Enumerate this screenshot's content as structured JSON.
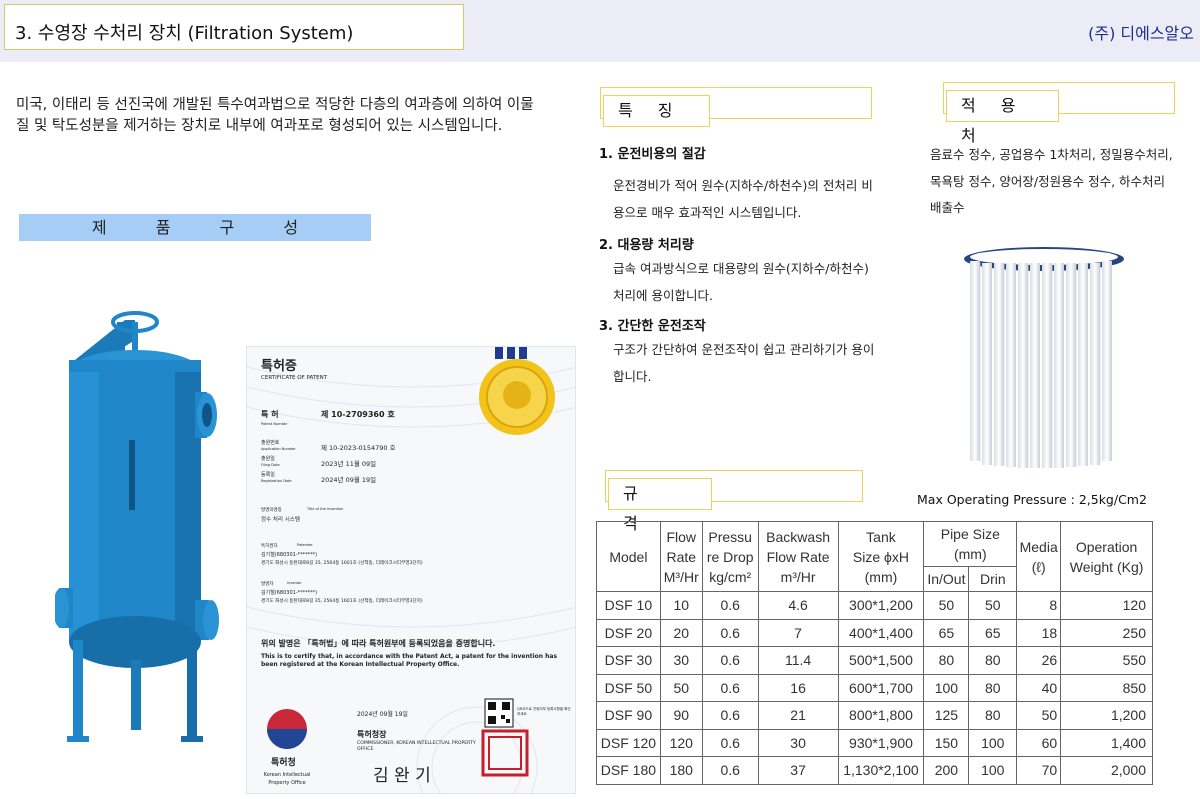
{
  "header": {
    "title": "3. 수영장 수처리 장치 (Filtration System)",
    "company": "(주) 디에스알오"
  },
  "intro": {
    "text": "미국, 이태리 등 선진국에 개발된 특수여과법으로 적당한 다층의 여과층에 의하여 이물질 및 탁도성분을 제거하는 장치로 내부에 여과포로 형성되어 있는 시스템입니다."
  },
  "composition": {
    "label": "제 품 구 성"
  },
  "features": {
    "heading": "특 징",
    "items": [
      {
        "title": "1. 운전비용의 절감",
        "desc": "운전경비가 적어 원수(지하수/하천수)의 전처리 비용으로 매우 효과적인 시스템입니다."
      },
      {
        "title": "2. 대용량 처리량",
        "desc": "급속 여과방식으로 대용량의 원수(지하수/하천수) 처리에 용이합니다."
      },
      {
        "title": "3. 간단한 운전조작",
        "desc": "구조가 간단하여 운전조작이 쉽고 관리하기가 용이합니다."
      }
    ]
  },
  "application": {
    "heading": "적 용 처",
    "text": "음료수 정수, 공업용수 1차처리, 정밀용수처리, 목욕탕 정수, 양어장/정원용수 정수, 하수처리 배출수"
  },
  "spec": {
    "heading": "규 격",
    "max_pressure": "Max Operating Pressure : 2,5kg/Cm2",
    "headers": {
      "model": "Model",
      "flow": [
        "Flow",
        "Rate",
        "M³/Hr"
      ],
      "pressure": [
        "Pressu",
        "re Drop",
        "kg/cm²"
      ],
      "backwash": [
        "Backwash",
        "Flow Rate",
        "m³/Hr"
      ],
      "tank": [
        "Tank",
        "Size ϕxH",
        "(mm)"
      ],
      "pipe": [
        "Pipe Size",
        "(mm)"
      ],
      "inout": "In/Out",
      "drin": "Drin",
      "media": [
        "Media",
        "(ℓ)"
      ],
      "weight": [
        "Operation",
        "Weight (Kg)"
      ]
    },
    "rows": [
      {
        "model": "DSF 10",
        "flow": "10",
        "pressure": "0.6",
        "backwash": "4.6",
        "tank": "300*1,200",
        "inout": "50",
        "drin": "50",
        "media": "8",
        "weight": "120"
      },
      {
        "model": "DSF 20",
        "flow": "20",
        "pressure": "0.6",
        "backwash": "7",
        "tank": "400*1,400",
        "inout": "65",
        "drin": "65",
        "media": "18",
        "weight": "250"
      },
      {
        "model": "DSF 30",
        "flow": "30",
        "pressure": "0.6",
        "backwash": "11.4",
        "tank": "500*1,500",
        "inout": "80",
        "drin": "80",
        "media": "26",
        "weight": "550"
      },
      {
        "model": "DSF 50",
        "flow": "50",
        "pressure": "0.6",
        "backwash": "16",
        "tank": "600*1,700",
        "inout": "100",
        "drin": "80",
        "media": "40",
        "weight": "850"
      },
      {
        "model": "DSF 90",
        "flow": "90",
        "pressure": "0.6",
        "backwash": "21",
        "tank": "800*1,800",
        "inout": "125",
        "drin": "80",
        "media": "50",
        "weight": "1,200"
      },
      {
        "model": "DSF 120",
        "flow": "120",
        "pressure": "0.6",
        "backwash": "30",
        "tank": "930*1,900",
        "inout": "150",
        "drin": "100",
        "media": "60",
        "weight": "1,400"
      },
      {
        "model": "DSF 180",
        "flow": "180",
        "pressure": "0.6",
        "backwash": "37",
        "tank": "1,130*2,100",
        "inout": "200",
        "drin": "100",
        "media": "70",
        "weight": "2,000"
      }
    ]
  },
  "certificate": {
    "title_ko": "특허증",
    "title_en": "CERTIFICATE OF PATENT",
    "patent_label": "특 허",
    "patent_sub": "Patent Number",
    "patent_no": "제 10-2709360 호",
    "app_label": "출원번호",
    "app_sub": "Application Number",
    "app_no": "제 10-2023-0154790 호",
    "filing_label": "출원일",
    "filing_sub": "Filing Date",
    "filing_date": "2023년 11월 09일",
    "reg_label": "등록일",
    "reg_sub": "Registration Date",
    "reg_date": "2024년 09월 19일",
    "invention_label": "발명의명칭",
    "invention_sub": "Title of the Invention",
    "invention": "정수 처리 시스템",
    "holder_label": "특허권자",
    "holder_sub": "Patentee",
    "holder_name": "김기철(680301-*******)",
    "holder_addr": "경기도 화성시 동탄대로8길 35, 2564동 1601호 (산척동, 더레이크시티부영3단지)",
    "inventor_label": "발명자",
    "inventor_sub": "Inventor",
    "inventor_name": "김기철(680301-*******)",
    "inventor_addr": "경기도 화성시 동탄대로8길 35, 2564동 1601호 (산척동, 더레이크시티부영3단지)",
    "statement_ko": "위의 발명은 「특허법」에 따라 특허원부에 등록되었음을 증명합니다.",
    "statement_en": "This is to certify that, in accordance with the Patent Act, a patent for the invention has been registered at the Korean Intellectual Property Office.",
    "issue_date": "2024년 09월 19일",
    "office_ko": "특허청",
    "office_en": "Korean Intellectual Property Office",
    "commissioner_ko": "특허청장",
    "commissioner_en": "COMMISSIONER, KOREAN INTELLECTUAL PROPERTY OFFICE",
    "signature": "김 완 기",
    "qr_note": "QR코드로 진위여부 등록사항을 확인하세요"
  },
  "colors": {
    "tank": "#1f86c9",
    "section_border": "#ecd35a",
    "composition_bar": "#a6cdf5",
    "header_bg": "#ececf6",
    "company": "#1d2f8c"
  }
}
